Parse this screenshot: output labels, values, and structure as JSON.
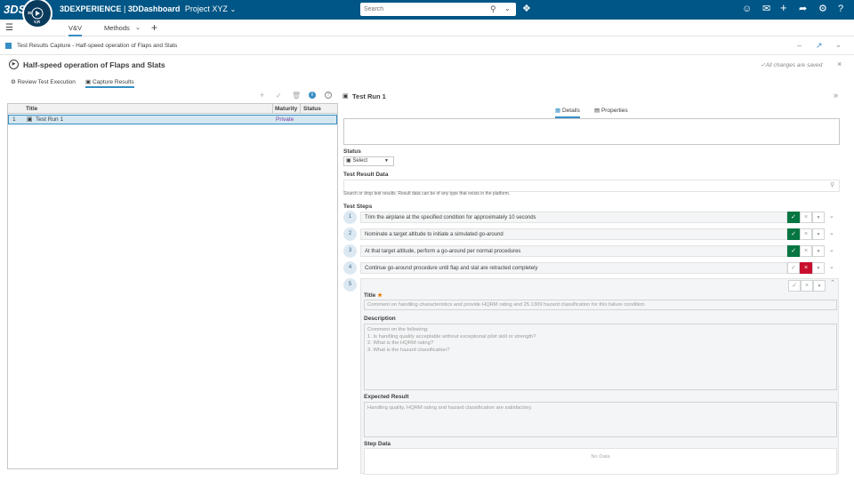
{
  "topbar": {
    "brand": "3DEXPERIENCE",
    "separator": " | ",
    "app": "3DDashboard",
    "project": "Project XYZ",
    "search_placeholder": "Search",
    "compass": {
      "north": "",
      "west": "3D",
      "east": "",
      "south": "V,R"
    }
  },
  "tabs": {
    "vv": "V&V",
    "methods": "Methods"
  },
  "breadcrumb": "Test Results Capture - Half-speed operation of Flaps and Slats",
  "page_title": "Half-speed operation of Flaps and Slats",
  "saved_status": "All changes are saved",
  "subtabs": {
    "review": "Review Test Execution",
    "capture": "Capture Results"
  },
  "grid": {
    "columns": [
      "Title",
      "Maturity",
      "Status"
    ],
    "rows": [
      {
        "index": "1",
        "title": "Test Run 1",
        "maturity": "Private",
        "status": ""
      }
    ]
  },
  "panel": {
    "title": "Test Run 1",
    "tab_details": "Details",
    "tab_properties": "Properties",
    "status_label": "Status",
    "status_value": "Select",
    "result_data_label": "Test Result Data",
    "result_hint": "Search or drop test results. Result data can be of any type that exists in the platform.",
    "steps_label": "Test Steps"
  },
  "steps": [
    {
      "num": "1",
      "text": "Trim the airplane at the specified condition for approximately 10 seconds",
      "result": "pass"
    },
    {
      "num": "2",
      "text": "Nominate a target altitude to initiate a simulated go-around",
      "result": "pass"
    },
    {
      "num": "3",
      "text": "At that target altitude, perform a go-around per normal procedures",
      "result": "pass"
    },
    {
      "num": "4",
      "text": "Continue go-around procedure until flap and slat are retracted completely",
      "result": "fail"
    },
    {
      "num": "5",
      "text": "",
      "result": "none"
    }
  ],
  "step5": {
    "title_label": "Title",
    "title_value": "Comment on handling characteristics and provide HQRM rating and 25.1309 hazard classification for this failure condition",
    "description_label": "Description",
    "description_lines": [
      "Comment on the following:",
      "1.     Is handling quality acceptable without exceptional pilot skill or strength?",
      "2.     What is the HQRM rating?",
      "3.     What is the hazard classification?"
    ],
    "expected_label": "Expected Result",
    "expected_value": "Handling quality, HQRM rating and hazard classification are satisfactory.",
    "step_data_label": "Step Data",
    "no_data": "No Data"
  },
  "colors": {
    "topbar": "#005686",
    "accent": "#368ec4",
    "pass": "#057642",
    "fail": "#c8102e",
    "private": "#7b3fa0"
  }
}
